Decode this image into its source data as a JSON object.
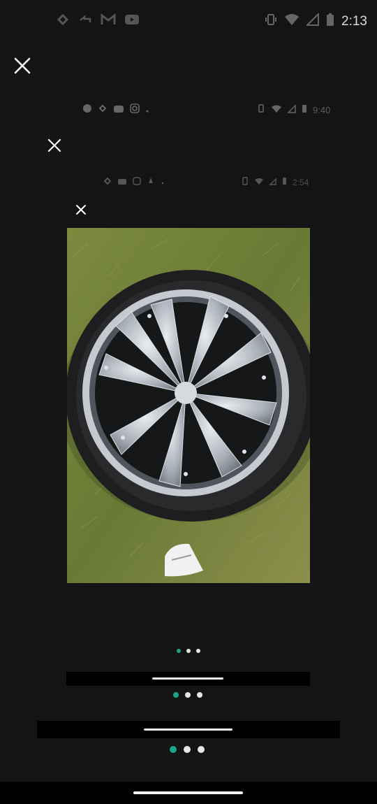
{
  "status_bar": {
    "time": "2:13",
    "left_icons": [
      "link-icon",
      "reply-icon",
      "gmail-icon",
      "youtube-icon"
    ],
    "right_icons": [
      "vibrate-icon",
      "wifi-icon",
      "signal-icon",
      "battery-icon"
    ]
  },
  "nested_status_1": {
    "time": "9:40"
  },
  "nested_status_2": {
    "time": "2:54"
  },
  "carousel": {
    "pages": 3,
    "active_index": 0
  },
  "colors": {
    "background": "#141414",
    "accent": "#1aa58a",
    "bar": "#000000"
  }
}
